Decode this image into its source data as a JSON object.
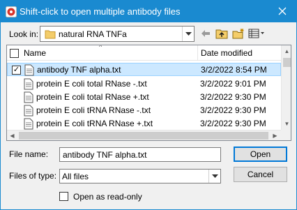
{
  "window": {
    "title": "Shift-click to open multiple antibody files"
  },
  "lookin": {
    "label": "Look in:",
    "value": "natural RNA TNFa"
  },
  "toolbar": {
    "icons": [
      "back-arrow-icon",
      "up-folder-icon",
      "new-folder-icon",
      "view-menu-icon"
    ]
  },
  "list": {
    "columns": {
      "name": "Name",
      "date": "Date modified"
    },
    "rows": [
      {
        "name": "antibody TNF alpha.txt",
        "date": "3/2/2022 8:54 PM",
        "checked": true,
        "selected": true
      },
      {
        "name": "protein E coli total RNase -.txt",
        "date": "3/2/2022 9:01 PM",
        "checked": false,
        "selected": false
      },
      {
        "name": "protein E coli total RNase +.txt",
        "date": "3/2/2022 9:30 PM",
        "checked": false,
        "selected": false
      },
      {
        "name": "protein E coli tRNA RNase -.txt",
        "date": "3/2/2022 9:30 PM",
        "checked": false,
        "selected": false
      },
      {
        "name": "protein E coli tRNA RNase +.txt",
        "date": "3/2/2022 9:30 PM",
        "checked": false,
        "selected": false
      }
    ]
  },
  "form": {
    "filename_label": "File name:",
    "filename_value": "antibody TNF alpha.txt",
    "filetype_label": "Files of type:",
    "filetype_value": "All files",
    "readonly_label": "Open as read-only",
    "open_label": "Open",
    "cancel_label": "Cancel"
  },
  "colors": {
    "titlebar": "#1a8ad0",
    "selection": "#cce8ff",
    "folder": "#e8b74a"
  }
}
